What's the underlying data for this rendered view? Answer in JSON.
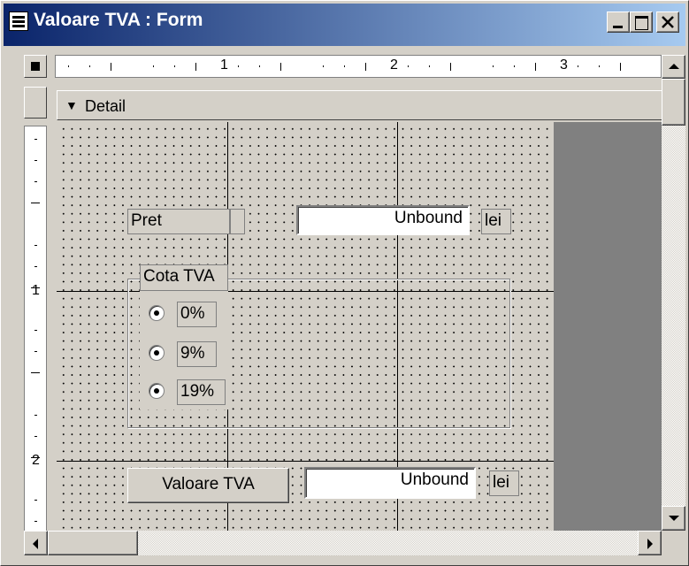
{
  "window": {
    "title": "Valoare TVA : Form",
    "controls": [
      "minimize-icon",
      "maximize-icon",
      "close-icon"
    ]
  },
  "ruler": {
    "horizontal_numbers": [
      "1",
      "2",
      "3"
    ],
    "vertical_numbers": [
      "1",
      "2"
    ]
  },
  "section": {
    "label": "Detail",
    "icon": "section-arrow-icon"
  },
  "form": {
    "pret_label": "Pret",
    "pret_textbox": "Unbound",
    "pret_unit": "lei",
    "option_group_label": "Cota TVA",
    "options": [
      {
        "label": "0%"
      },
      {
        "label": "9%"
      },
      {
        "label": "19%"
      }
    ],
    "button_label": "Valoare TVA",
    "result_textbox": "Unbound",
    "result_unit": "lei"
  },
  "colors": {
    "titlebar_start": "#0a246a",
    "titlebar_end": "#a6caf0",
    "face": "#d4d0c8"
  }
}
